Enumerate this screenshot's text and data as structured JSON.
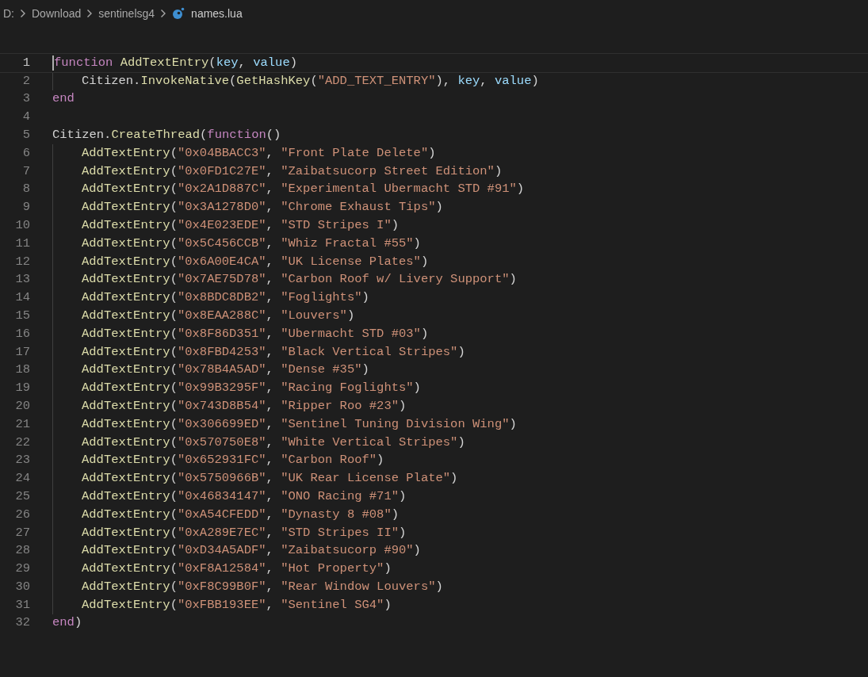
{
  "breadcrumb": [
    {
      "label": "D:",
      "kind": "folder"
    },
    {
      "label": "Download",
      "kind": "folder"
    },
    {
      "label": "sentinelsg4",
      "kind": "folder"
    },
    {
      "label": "names.lua",
      "kind": "file"
    }
  ],
  "editor": {
    "lines": [
      {
        "number": "1",
        "current": true,
        "tokens": [
          {
            "kind": "keyword",
            "text": "function "
          },
          {
            "kind": "function",
            "text": "AddTextEntry"
          },
          {
            "kind": "plain",
            "text": "("
          },
          {
            "kind": "variable",
            "text": "key"
          },
          {
            "kind": "plain",
            "text": ", "
          },
          {
            "kind": "variable",
            "text": "value"
          },
          {
            "kind": "plain",
            "text": ")"
          }
        ],
        "children": [
          {
            "number": "2",
            "current": false,
            "tokens": [
              {
                "kind": "plain",
                "text": "Citizen."
              },
              {
                "kind": "function",
                "text": "InvokeNative"
              },
              {
                "kind": "plain",
                "text": "("
              },
              {
                "kind": "function",
                "text": "GetHashKey"
              },
              {
                "kind": "plain",
                "text": "("
              },
              {
                "kind": "string",
                "text": "\"ADD_TEXT_ENTRY\""
              },
              {
                "kind": "plain",
                "text": "), "
              },
              {
                "kind": "variable",
                "text": "key"
              },
              {
                "kind": "plain",
                "text": ", "
              },
              {
                "kind": "variable",
                "text": "value"
              },
              {
                "kind": "plain",
                "text": ")"
              }
            ]
          }
        ]
      },
      {
        "number": "3",
        "current": false,
        "tokens": [
          {
            "kind": "keyword",
            "text": "end"
          }
        ]
      },
      {
        "number": "4",
        "current": false
      },
      {
        "number": "5",
        "current": false,
        "tokens": [
          {
            "kind": "plain",
            "text": "Citizen."
          },
          {
            "kind": "function",
            "text": "CreateThread"
          },
          {
            "kind": "plain",
            "text": "("
          },
          {
            "kind": "keyword",
            "text": "function"
          },
          {
            "kind": "plain",
            "text": "()"
          }
        ],
        "children": [
          {
            "number": "6",
            "current": false,
            "tokens": [
              {
                "kind": "function",
                "text": "AddTextEntry"
              },
              {
                "kind": "plain",
                "text": "("
              },
              {
                "kind": "string",
                "text": "\"0x04BBACC3\""
              },
              {
                "kind": "plain",
                "text": ", "
              },
              {
                "kind": "string",
                "text": "\"Front Plate Delete\""
              },
              {
                "kind": "plain",
                "text": ")"
              }
            ]
          },
          {
            "number": "7",
            "current": false,
            "tokens": [
              {
                "kind": "function",
                "text": "AddTextEntry"
              },
              {
                "kind": "plain",
                "text": "("
              },
              {
                "kind": "string",
                "text": "\"0x0FD1C27E\""
              },
              {
                "kind": "plain",
                "text": ", "
              },
              {
                "kind": "string",
                "text": "\"Zaibatsucorp Street Edition\""
              },
              {
                "kind": "plain",
                "text": ")"
              }
            ]
          },
          {
            "number": "8",
            "current": false,
            "tokens": [
              {
                "kind": "function",
                "text": "AddTextEntry"
              },
              {
                "kind": "plain",
                "text": "("
              },
              {
                "kind": "string",
                "text": "\"0x2A1D887C\""
              },
              {
                "kind": "plain",
                "text": ", "
              },
              {
                "kind": "string",
                "text": "\"Experimental Ubermacht STD #91\""
              },
              {
                "kind": "plain",
                "text": ")"
              }
            ]
          },
          {
            "number": "9",
            "current": false,
            "tokens": [
              {
                "kind": "function",
                "text": "AddTextEntry"
              },
              {
                "kind": "plain",
                "text": "("
              },
              {
                "kind": "string",
                "text": "\"0x3A1278D0\""
              },
              {
                "kind": "plain",
                "text": ", "
              },
              {
                "kind": "string",
                "text": "\"Chrome Exhaust Tips\""
              },
              {
                "kind": "plain",
                "text": ")"
              }
            ]
          },
          {
            "number": "10",
            "current": false,
            "tokens": [
              {
                "kind": "function",
                "text": "AddTextEntry"
              },
              {
                "kind": "plain",
                "text": "("
              },
              {
                "kind": "string",
                "text": "\"0x4E023EDE\""
              },
              {
                "kind": "plain",
                "text": ", "
              },
              {
                "kind": "string",
                "text": "\"STD Stripes I\""
              },
              {
                "kind": "plain",
                "text": ")"
              }
            ]
          },
          {
            "number": "11",
            "current": false,
            "tokens": [
              {
                "kind": "function",
                "text": "AddTextEntry"
              },
              {
                "kind": "plain",
                "text": "("
              },
              {
                "kind": "string",
                "text": "\"0x5C456CCB\""
              },
              {
                "kind": "plain",
                "text": ", "
              },
              {
                "kind": "string",
                "text": "\"Whiz Fractal #55\""
              },
              {
                "kind": "plain",
                "text": ")"
              }
            ]
          },
          {
            "number": "12",
            "current": false,
            "tokens": [
              {
                "kind": "function",
                "text": "AddTextEntry"
              },
              {
                "kind": "plain",
                "text": "("
              },
              {
                "kind": "string",
                "text": "\"0x6A00E4CA\""
              },
              {
                "kind": "plain",
                "text": ", "
              },
              {
                "kind": "string",
                "text": "\"UK License Plates\""
              },
              {
                "kind": "plain",
                "text": ")"
              }
            ]
          },
          {
            "number": "13",
            "current": false,
            "tokens": [
              {
                "kind": "function",
                "text": "AddTextEntry"
              },
              {
                "kind": "plain",
                "text": "("
              },
              {
                "kind": "string",
                "text": "\"0x7AE75D78\""
              },
              {
                "kind": "plain",
                "text": ", "
              },
              {
                "kind": "string",
                "text": "\"Carbon Roof w/ Livery Support\""
              },
              {
                "kind": "plain",
                "text": ")"
              }
            ]
          },
          {
            "number": "14",
            "current": false,
            "tokens": [
              {
                "kind": "function",
                "text": "AddTextEntry"
              },
              {
                "kind": "plain",
                "text": "("
              },
              {
                "kind": "string",
                "text": "\"0x8BDC8DB2\""
              },
              {
                "kind": "plain",
                "text": ", "
              },
              {
                "kind": "string",
                "text": "\"Foglights\""
              },
              {
                "kind": "plain",
                "text": ")"
              }
            ]
          },
          {
            "number": "15",
            "current": false,
            "tokens": [
              {
                "kind": "function",
                "text": "AddTextEntry"
              },
              {
                "kind": "plain",
                "text": "("
              },
              {
                "kind": "string",
                "text": "\"0x8EAA288C\""
              },
              {
                "kind": "plain",
                "text": ", "
              },
              {
                "kind": "string",
                "text": "\"Louvers\""
              },
              {
                "kind": "plain",
                "text": ")"
              }
            ]
          },
          {
            "number": "16",
            "current": false,
            "tokens": [
              {
                "kind": "function",
                "text": "AddTextEntry"
              },
              {
                "kind": "plain",
                "text": "("
              },
              {
                "kind": "string",
                "text": "\"0x8F86D351\""
              },
              {
                "kind": "plain",
                "text": ", "
              },
              {
                "kind": "string",
                "text": "\"Ubermacht STD #03\""
              },
              {
                "kind": "plain",
                "text": ")"
              }
            ]
          },
          {
            "number": "17",
            "current": false,
            "tokens": [
              {
                "kind": "function",
                "text": "AddTextEntry"
              },
              {
                "kind": "plain",
                "text": "("
              },
              {
                "kind": "string",
                "text": "\"0x8FBD4253\""
              },
              {
                "kind": "plain",
                "text": ", "
              },
              {
                "kind": "string",
                "text": "\"Black Vertical Stripes\""
              },
              {
                "kind": "plain",
                "text": ")"
              }
            ]
          },
          {
            "number": "18",
            "current": false,
            "tokens": [
              {
                "kind": "function",
                "text": "AddTextEntry"
              },
              {
                "kind": "plain",
                "text": "("
              },
              {
                "kind": "string",
                "text": "\"0x78B4A5AD\""
              },
              {
                "kind": "plain",
                "text": ", "
              },
              {
                "kind": "string",
                "text": "\"Dense #35\""
              },
              {
                "kind": "plain",
                "text": ")"
              }
            ]
          },
          {
            "number": "19",
            "current": false,
            "tokens": [
              {
                "kind": "function",
                "text": "AddTextEntry"
              },
              {
                "kind": "plain",
                "text": "("
              },
              {
                "kind": "string",
                "text": "\"0x99B3295F\""
              },
              {
                "kind": "plain",
                "text": ", "
              },
              {
                "kind": "string",
                "text": "\"Racing Foglights\""
              },
              {
                "kind": "plain",
                "text": ")"
              }
            ]
          },
          {
            "number": "20",
            "current": false,
            "tokens": [
              {
                "kind": "function",
                "text": "AddTextEntry"
              },
              {
                "kind": "plain",
                "text": "("
              },
              {
                "kind": "string",
                "text": "\"0x743D8B54\""
              },
              {
                "kind": "plain",
                "text": ", "
              },
              {
                "kind": "string",
                "text": "\"Ripper Roo #23\""
              },
              {
                "kind": "plain",
                "text": ")"
              }
            ]
          },
          {
            "number": "21",
            "current": false,
            "tokens": [
              {
                "kind": "function",
                "text": "AddTextEntry"
              },
              {
                "kind": "plain",
                "text": "("
              },
              {
                "kind": "string",
                "text": "\"0x306699ED\""
              },
              {
                "kind": "plain",
                "text": ", "
              },
              {
                "kind": "string",
                "text": "\"Sentinel Tuning Division Wing\""
              },
              {
                "kind": "plain",
                "text": ")"
              }
            ]
          },
          {
            "number": "22",
            "current": false,
            "tokens": [
              {
                "kind": "function",
                "text": "AddTextEntry"
              },
              {
                "kind": "plain",
                "text": "("
              },
              {
                "kind": "string",
                "text": "\"0x570750E8\""
              },
              {
                "kind": "plain",
                "text": ", "
              },
              {
                "kind": "string",
                "text": "\"White Vertical Stripes\""
              },
              {
                "kind": "plain",
                "text": ")"
              }
            ]
          },
          {
            "number": "23",
            "current": false,
            "tokens": [
              {
                "kind": "function",
                "text": "AddTextEntry"
              },
              {
                "kind": "plain",
                "text": "("
              },
              {
                "kind": "string",
                "text": "\"0x652931FC\""
              },
              {
                "kind": "plain",
                "text": ", "
              },
              {
                "kind": "string",
                "text": "\"Carbon Roof\""
              },
              {
                "kind": "plain",
                "text": ")"
              }
            ]
          },
          {
            "number": "24",
            "current": false,
            "tokens": [
              {
                "kind": "function",
                "text": "AddTextEntry"
              },
              {
                "kind": "plain",
                "text": "("
              },
              {
                "kind": "string",
                "text": "\"0x5750966B\""
              },
              {
                "kind": "plain",
                "text": ", "
              },
              {
                "kind": "string",
                "text": "\"UK Rear License Plate\""
              },
              {
                "kind": "plain",
                "text": ")"
              }
            ]
          },
          {
            "number": "25",
            "current": false,
            "tokens": [
              {
                "kind": "function",
                "text": "AddTextEntry"
              },
              {
                "kind": "plain",
                "text": "("
              },
              {
                "kind": "string",
                "text": "\"0x46834147\""
              },
              {
                "kind": "plain",
                "text": ", "
              },
              {
                "kind": "string",
                "text": "\"ONO Racing #71\""
              },
              {
                "kind": "plain",
                "text": ")"
              }
            ]
          },
          {
            "number": "26",
            "current": false,
            "tokens": [
              {
                "kind": "function",
                "text": "AddTextEntry"
              },
              {
                "kind": "plain",
                "text": "("
              },
              {
                "kind": "string",
                "text": "\"0xA54CFEDD\""
              },
              {
                "kind": "plain",
                "text": ", "
              },
              {
                "kind": "string",
                "text": "\"Dynasty 8 #08\""
              },
              {
                "kind": "plain",
                "text": ")"
              }
            ]
          },
          {
            "number": "27",
            "current": false,
            "tokens": [
              {
                "kind": "function",
                "text": "AddTextEntry"
              },
              {
                "kind": "plain",
                "text": "("
              },
              {
                "kind": "string",
                "text": "\"0xA289E7EC\""
              },
              {
                "kind": "plain",
                "text": ", "
              },
              {
                "kind": "string",
                "text": "\"STD Stripes II\""
              },
              {
                "kind": "plain",
                "text": ")"
              }
            ]
          },
          {
            "number": "28",
            "current": false,
            "tokens": [
              {
                "kind": "function",
                "text": "AddTextEntry"
              },
              {
                "kind": "plain",
                "text": "("
              },
              {
                "kind": "string",
                "text": "\"0xD34A5ADF\""
              },
              {
                "kind": "plain",
                "text": ", "
              },
              {
                "kind": "string",
                "text": "\"Zaibatsucorp #90\""
              },
              {
                "kind": "plain",
                "text": ")"
              }
            ]
          },
          {
            "number": "29",
            "current": false,
            "tokens": [
              {
                "kind": "function",
                "text": "AddTextEntry"
              },
              {
                "kind": "plain",
                "text": "("
              },
              {
                "kind": "string",
                "text": "\"0xF8A12584\""
              },
              {
                "kind": "plain",
                "text": ", "
              },
              {
                "kind": "string",
                "text": "\"Hot Property\""
              },
              {
                "kind": "plain",
                "text": ")"
              }
            ]
          },
          {
            "number": "30",
            "current": false,
            "tokens": [
              {
                "kind": "function",
                "text": "AddTextEntry"
              },
              {
                "kind": "plain",
                "text": "("
              },
              {
                "kind": "string",
                "text": "\"0xF8C99B0F\""
              },
              {
                "kind": "plain",
                "text": ", "
              },
              {
                "kind": "string",
                "text": "\"Rear Window Louvers\""
              },
              {
                "kind": "plain",
                "text": ")"
              }
            ]
          },
          {
            "number": "31",
            "current": false,
            "tokens": [
              {
                "kind": "function",
                "text": "AddTextEntry"
              },
              {
                "kind": "plain",
                "text": "("
              },
              {
                "kind": "string",
                "text": "\"0xFBB193EE\""
              },
              {
                "kind": "plain",
                "text": ", "
              },
              {
                "kind": "string",
                "text": "\"Sentinel SG4\""
              },
              {
                "kind": "plain",
                "text": ")"
              }
            ]
          }
        ]
      },
      {
        "number": "32",
        "current": false,
        "tokens": [
          {
            "kind": "keyword",
            "text": "end"
          },
          {
            "kind": "plain",
            "text": ")"
          }
        ]
      }
    ]
  }
}
